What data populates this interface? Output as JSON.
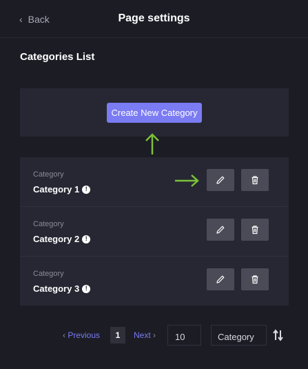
{
  "header": {
    "back_label": "Back",
    "title": "Page settings"
  },
  "section_title": "Categories List",
  "create_button_label": "Create New Category",
  "categories": [
    {
      "label": "Category",
      "name": "Category 1"
    },
    {
      "label": "Category",
      "name": "Category 2"
    },
    {
      "label": "Category",
      "name": "Category 3"
    }
  ],
  "pagination": {
    "prev_label": "Previous",
    "current_page": "1",
    "next_label": "Next",
    "per_page": "10",
    "sort_field": "Category"
  },
  "icons": {
    "back": "chevron-left-icon",
    "warning": "exclamation-circle-icon",
    "edit": "pencil-icon",
    "delete": "trash-icon",
    "sort": "sort-arrows-icon",
    "annotation": "arrow-icon"
  },
  "colors": {
    "background": "#1c1c25",
    "panel": "#272733",
    "accent": "#7b7bf3",
    "icon_button": "#4b4b57",
    "annotation_arrow": "#7cc23a"
  }
}
